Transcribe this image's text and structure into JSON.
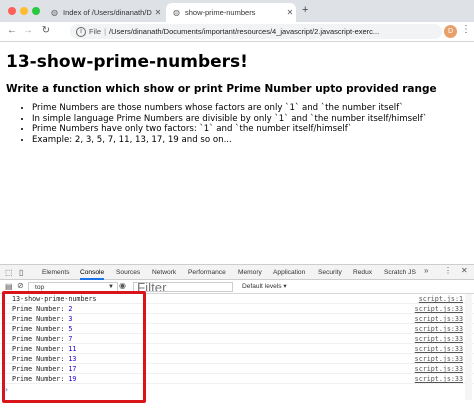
{
  "browser": {
    "tabs": [
      {
        "title": "Index of /Users/dinanath/Docum",
        "active": false
      },
      {
        "title": "show-prime-numbers",
        "active": true
      }
    ],
    "url_scheme": "File",
    "url": "/Users/dinanath/Documents/important/resources/4_javascript/2.javascript-exerc...",
    "profile_initial": "D"
  },
  "page": {
    "heading": "13-show-prime-numbers!",
    "subheading": "Write a function which show or print Prime Number upto provided range",
    "bullets": [
      "Prime Numbers are those numbers whose factors are only `1` and `the number itself`",
      "In simple language Prime Numbers are divisible by only `1` and `the number itself/himself`",
      "Prime Numbers have only two factors: `1` and `the number itself/himself`",
      "Example: 2, 3, 5, 7, 11, 13, 17, 19 and so on..."
    ]
  },
  "devtools": {
    "tabs": [
      "Elements",
      "Console",
      "Sources",
      "Network",
      "Performance",
      "Memory",
      "Application",
      "Security",
      "Redux",
      "Scratch JS"
    ],
    "active_tab": "Console",
    "context": "top",
    "filter_placeholder": "Filter",
    "levels": "Default levels ▾",
    "logs": [
      {
        "label": "13-show-prime-numbers",
        "value": "",
        "source": "script.js:1"
      },
      {
        "label": "Prime Number: ",
        "value": "2",
        "source": "script.js:33"
      },
      {
        "label": "Prime Number: ",
        "value": "3",
        "source": "script.js:33"
      },
      {
        "label": "Prime Number: ",
        "value": "5",
        "source": "script.js:33"
      },
      {
        "label": "Prime Number: ",
        "value": "7",
        "source": "script.js:33"
      },
      {
        "label": "Prime Number: ",
        "value": "11",
        "source": "script.js:33"
      },
      {
        "label": "Prime Number: ",
        "value": "13",
        "source": "script.js:33"
      },
      {
        "label": "Prime Number: ",
        "value": "17",
        "source": "script.js:33"
      },
      {
        "label": "Prime Number: ",
        "value": "19",
        "source": "script.js:33"
      }
    ],
    "highlight_color": "#d9141b"
  }
}
